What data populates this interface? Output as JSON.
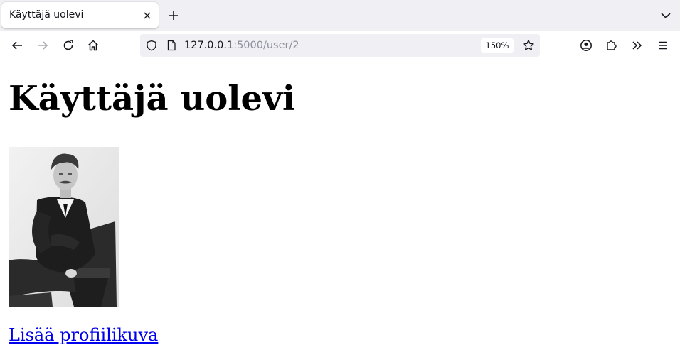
{
  "browser": {
    "tab": {
      "title": "Käyttäjä uolevi"
    },
    "url": {
      "host": "127.0.0.1",
      "path": ":5000/user/2"
    },
    "zoom": "150%"
  },
  "page": {
    "title": "Käyttäjä uolevi",
    "add_profile_image_link": "Lisää profiilikuva"
  },
  "colors": {
    "link": "#0000ee",
    "chrome": "#f0f0f4"
  }
}
